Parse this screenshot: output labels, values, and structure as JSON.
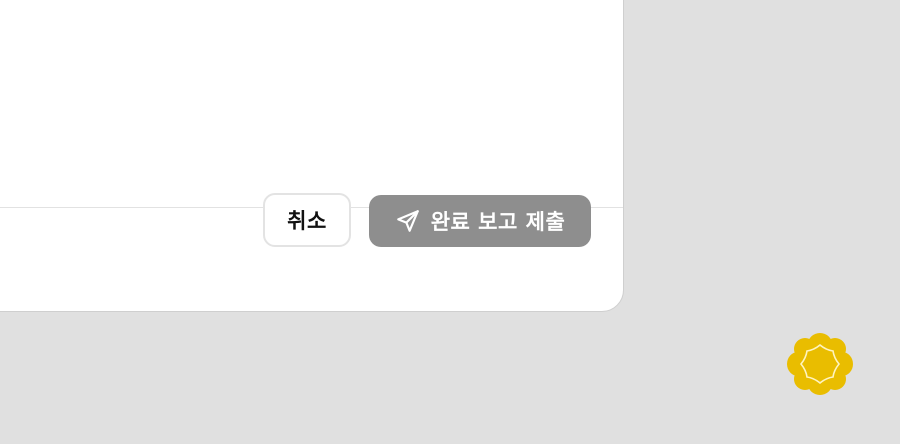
{
  "dialog": {
    "footer": {
      "cancel_label": "취소",
      "submit_label": "완료 보고 제출",
      "submit_icon": "send-icon"
    }
  },
  "badge": {
    "icon": "sparkle-badge-icon",
    "color": "#e9bd00"
  },
  "colors": {
    "background": "#e0e0e0",
    "dialog": "#ffffff",
    "submit_disabled": "#8e8e8e"
  }
}
